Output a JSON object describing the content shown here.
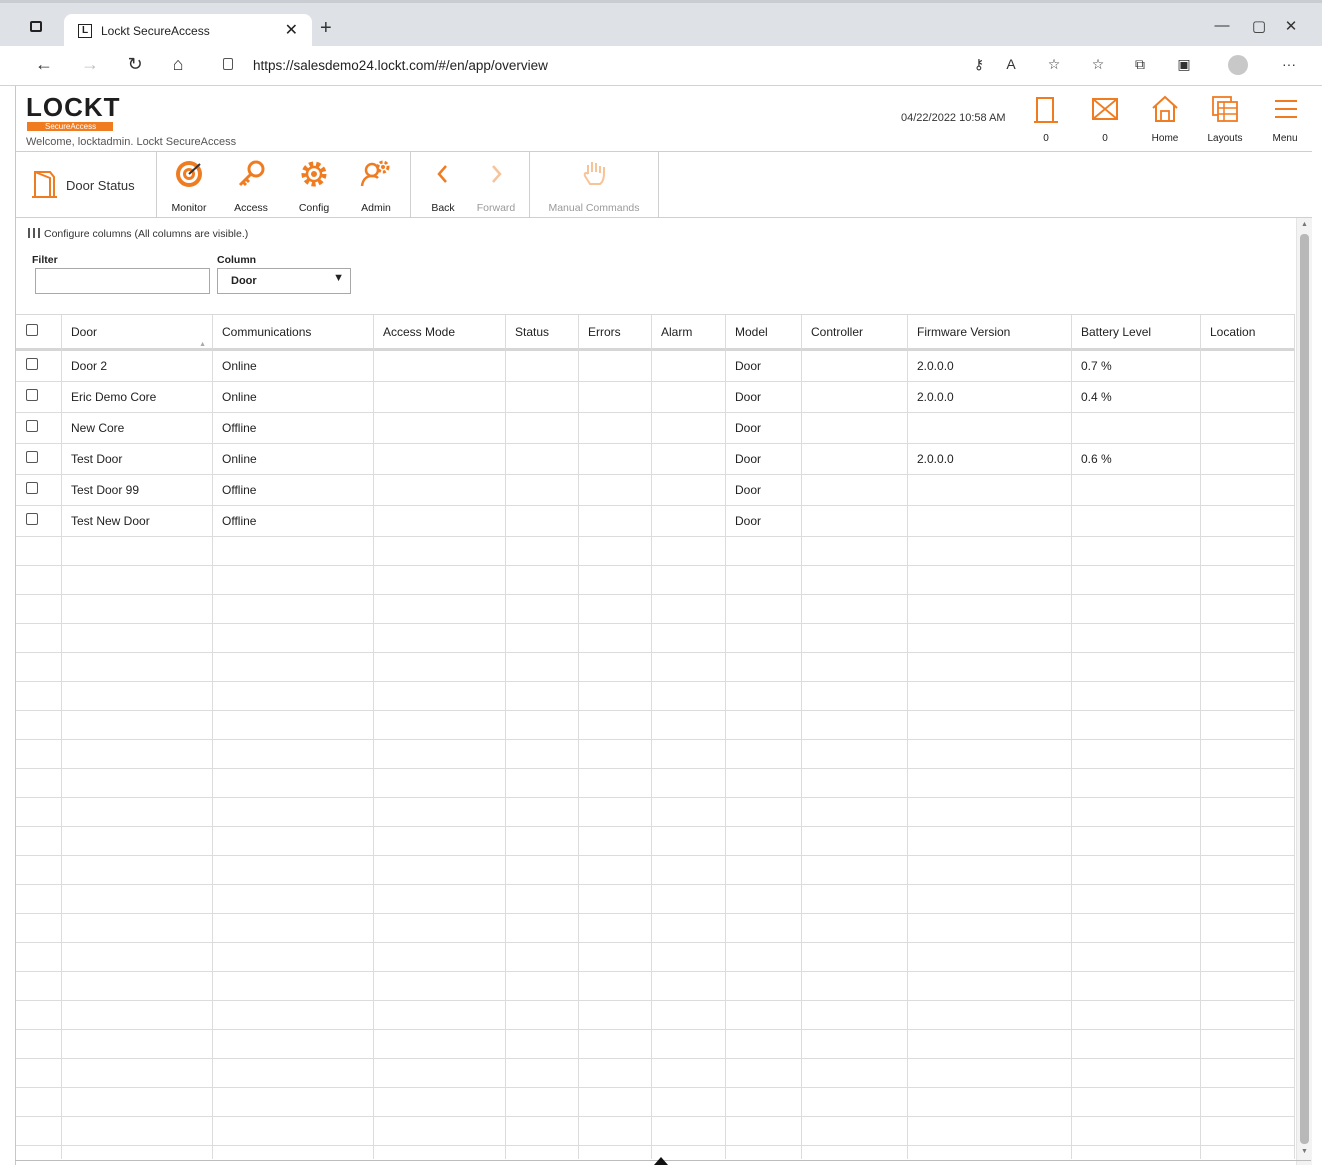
{
  "browser": {
    "tab_title": "Lockt SecureAccess",
    "tab_favicon_letter": "L",
    "url": "https://salesdemo24.lockt.com/#/en/app/overview",
    "win_min": "—",
    "win_max": "▢",
    "win_close": "✕",
    "new_tab": "+",
    "tab_close": "✕"
  },
  "app": {
    "logo_word": "LOCKT",
    "logo_sub": "SecureAccess",
    "welcome": "Welcome, locktadmin.  Lockt SecureAccess",
    "datetime": "04/22/2022 10:58 AM",
    "header_items": [
      {
        "label": "0",
        "icon": "door-icon"
      },
      {
        "label": "0",
        "icon": "mail-icon"
      },
      {
        "label": "Home",
        "icon": "home-icon"
      },
      {
        "label": "Layouts",
        "icon": "layouts-icon"
      },
      {
        "label": "Menu",
        "icon": "menu-icon"
      }
    ],
    "accent_color": "#f07c22"
  },
  "toolbar": {
    "page_label": "Door Status",
    "buttons": [
      {
        "label": "Monitor",
        "icon": "monitor-target-icon"
      },
      {
        "label": "Access",
        "icon": "access-key-icon"
      },
      {
        "label": "Config",
        "icon": "config-gear-icon"
      },
      {
        "label": "Admin",
        "icon": "admin-user-gear-icon"
      },
      {
        "label": "Back",
        "icon": "back-chevron-icon"
      },
      {
        "label": "Forward",
        "icon": "forward-chevron-icon",
        "disabled": true
      },
      {
        "label": "Manual Commands",
        "icon": "hand-icon",
        "disabled": true
      }
    ]
  },
  "filters": {
    "configure_text": "Configure columns (All columns are visible.)",
    "filter_label": "Filter",
    "filter_value": "",
    "column_label": "Column",
    "column_value": "Door"
  },
  "table": {
    "columns": [
      "Door",
      "Communications",
      "Access Mode",
      "Status",
      "Errors",
      "Alarm",
      "Model",
      "Controller",
      "Firmware Version",
      "Battery Level",
      "Location"
    ],
    "rows": [
      [
        "Door 2",
        "Online",
        "",
        "",
        "",
        "",
        "Door",
        "",
        "2.0.0.0",
        "0.7 %",
        ""
      ],
      [
        "Eric Demo Core",
        "Online",
        "",
        "",
        "",
        "",
        "Door",
        "",
        "2.0.0.0",
        "0.4 %",
        ""
      ],
      [
        "New Core",
        "Offline",
        "",
        "",
        "",
        "",
        "Door",
        "",
        "",
        "",
        ""
      ],
      [
        "Test Door",
        "Online",
        "",
        "",
        "",
        "",
        "Door",
        "",
        "2.0.0.0",
        "0.6 %",
        ""
      ],
      [
        "Test Door 99",
        "Offline",
        "",
        "",
        "",
        "",
        "Door",
        "",
        "",
        "",
        ""
      ],
      [
        "Test New Door",
        "Offline",
        "",
        "",
        "",
        "",
        "Door",
        "",
        "",
        "",
        ""
      ]
    ]
  }
}
